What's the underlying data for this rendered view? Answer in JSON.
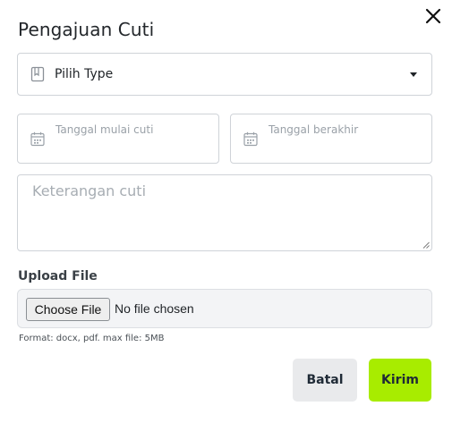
{
  "modal": {
    "title": "Pengajuan Cuti"
  },
  "type_select": {
    "icon": "book-icon",
    "label": "Pilih Type"
  },
  "start_date": {
    "icon": "calendar-icon",
    "placeholder": "Tanggal mulai cuti"
  },
  "end_date": {
    "icon": "calendar-icon",
    "placeholder": "Tanggal berakhir"
  },
  "notes": {
    "placeholder": "Keterangan cuti"
  },
  "upload": {
    "label": "Upload File",
    "button_label": "Choose File",
    "status": "No file chosen",
    "help": "Format: docx, pdf. max file: 5MB"
  },
  "actions": {
    "cancel_label": "Batal",
    "submit_label": "Kirim"
  },
  "colors": {
    "submit": "#a8ec00",
    "cancel": "#e9eaec"
  }
}
